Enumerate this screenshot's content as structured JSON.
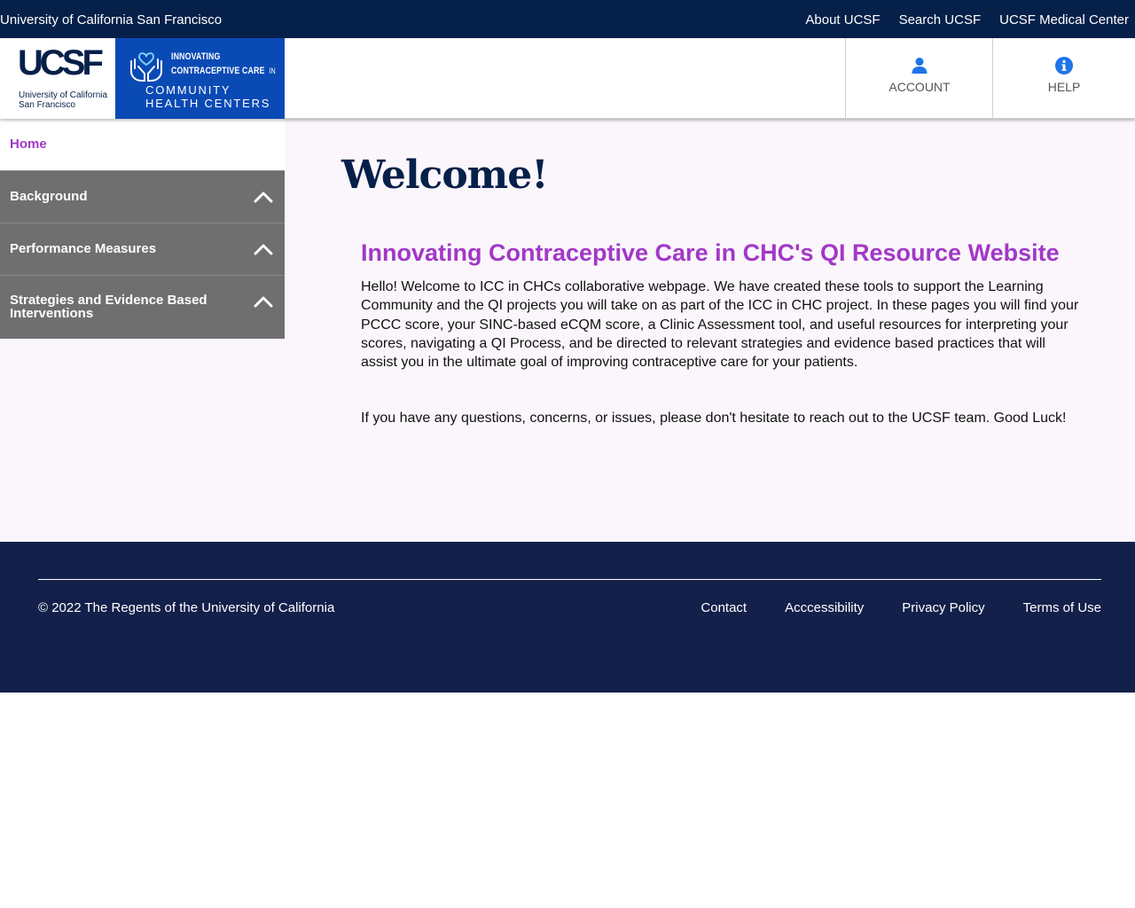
{
  "topbar": {
    "org_name": "University of California San Francisco",
    "links": [
      "About UCSF",
      "Search UCSF",
      "UCSF Medical Center"
    ]
  },
  "header": {
    "ucsf_logo": {
      "mark": "UCSF",
      "sub_line1": "University of California",
      "sub_line2": "San Francisco"
    },
    "icc_logo": {
      "line1": "INNOVATING",
      "line2": "CONTRACEPTIVE CARE",
      "line2_small": "IN",
      "line3": "COMMUNITY",
      "line4": "HEALTH CENTERS"
    },
    "account_label": "ACCOUNT",
    "help_label": "HELP",
    "account_icon": "user-icon",
    "help_icon": "info-icon"
  },
  "sidebar": {
    "home": "Home",
    "items": [
      {
        "label": "Background"
      },
      {
        "label": "Performance Measures"
      },
      {
        "label": "Strategies and Evidence Based Interventions"
      }
    ]
  },
  "main": {
    "welcome": "Welcome!",
    "subhead": "Innovating Contraceptive Care in CHC's QI Resource Website",
    "paragraph1": "Hello! Welcome to ICC in CHCs collaborative webpage. We have created these tools to support the Learning Community and the QI projects you will take on as part of the ICC in CHC project. In these pages you will find your PCCC score, your SINC-based eCQM score, a Clinic Assessment tool, and useful resources for interpreting your scores, navigating a QI Process, and be directed to relevant strategies and evidence based practices that will assist you in the ultimate goal of improving contraceptive care for your patients.",
    "paragraph2": "If you have any questions, concerns, or issues, please don't hesitate to reach out to the UCSF team. Good Luck!"
  },
  "footer": {
    "copyright": "© 2022 The Regents of the University of California",
    "links": [
      "Contact",
      "Acccessibility",
      "Privacy Policy",
      "Terms of Use"
    ]
  },
  "colors": {
    "navy": "#052049",
    "footer_navy": "#13204a",
    "accent_purple": "#a238c7",
    "sidebar_gray": "#6f6f70",
    "icc_blue": "#0a4ab5",
    "icon_blue": "#1f74e8"
  }
}
